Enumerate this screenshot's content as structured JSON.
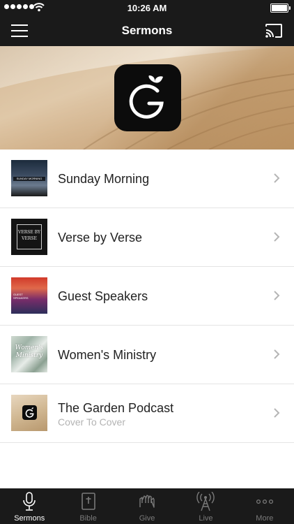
{
  "status_bar": {
    "time": "10:26 AM"
  },
  "navbar": {
    "title": "Sermons"
  },
  "list": [
    {
      "title": "Sunday Morning",
      "thumb_text": "SUNDAY MORNING"
    },
    {
      "title": "Verse by Verse",
      "thumb_text": "VERSE BY VERSE"
    },
    {
      "title": "Guest Speakers",
      "thumb_text": "GUEST SPEAKERS"
    },
    {
      "title": "Women's Ministry",
      "thumb_text": "Women's Ministry"
    },
    {
      "title": "The Garden Podcast",
      "subtitle": "Cover To Cover"
    }
  ],
  "tabbar": [
    {
      "label": "Sermons",
      "icon": "microphone-icon"
    },
    {
      "label": "Bible",
      "icon": "bible-icon"
    },
    {
      "label": "Give",
      "icon": "give-hands-icon"
    },
    {
      "label": "Live",
      "icon": "broadcast-tower-icon"
    },
    {
      "label": "More",
      "icon": "more-dots-icon"
    }
  ],
  "colors": {
    "bar": "#1a1a1a",
    "active_tab": "#ffffff",
    "inactive_tab": "#7a7a7a",
    "logo_bg": "#0c0c0c"
  }
}
